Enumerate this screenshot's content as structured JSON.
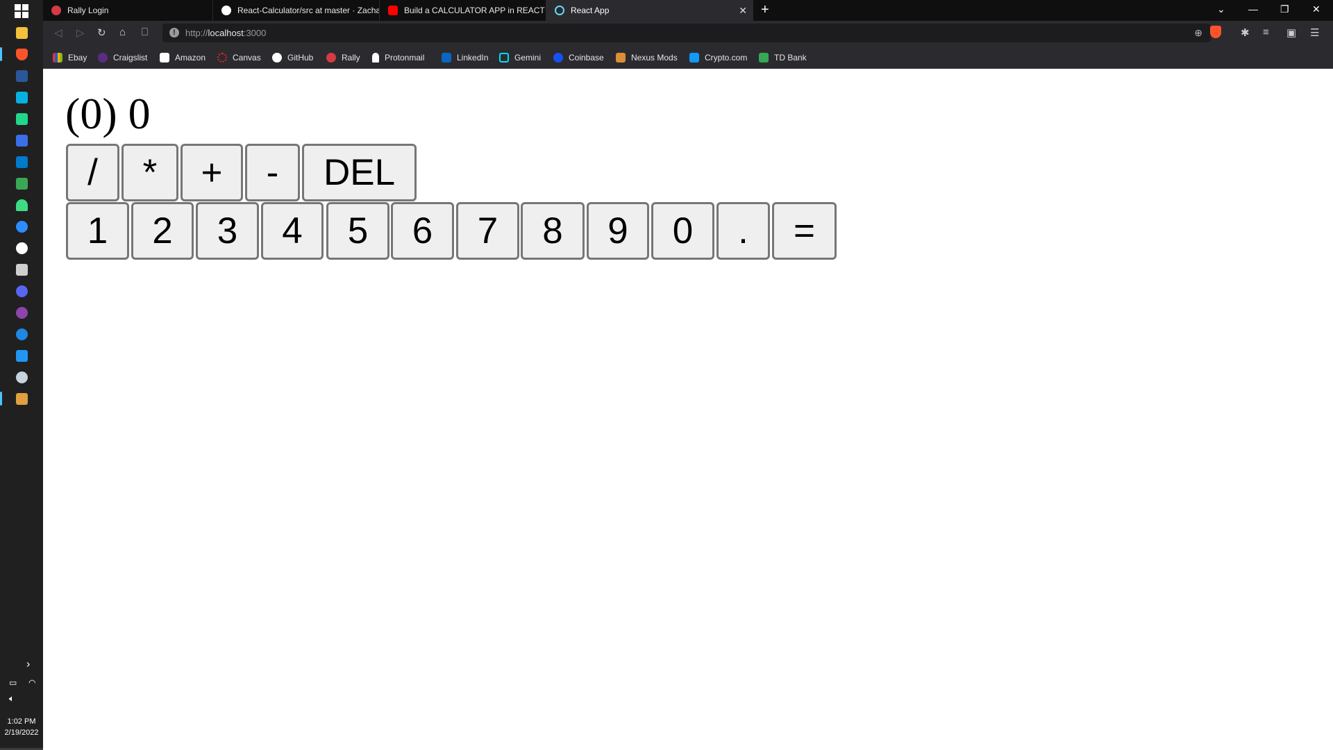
{
  "taskbar": {
    "time": "1:02 PM",
    "date": "2/19/2022"
  },
  "tabs": [
    {
      "title": "Rally Login",
      "color": "#d63a45"
    },
    {
      "title": "React-Calculator/src at master · Zachary",
      "color": "#ffffff"
    },
    {
      "title": "Build a CALCULATOR APP in REACT JS",
      "color": "#ff0000"
    },
    {
      "title": "React App",
      "color": "#61dafb"
    }
  ],
  "toolbar": {
    "url_prefix": "http://",
    "url_host": "localhost",
    "url_suffix": ":3000"
  },
  "bookmarks": [
    {
      "label": "Ebay",
      "color": "#e53238"
    },
    {
      "label": "Craigslist",
      "color": "#5a2d82"
    },
    {
      "label": "Amazon",
      "color": "#ffffff"
    },
    {
      "label": "Canvas",
      "color": "#e4222e"
    },
    {
      "label": "GitHub",
      "color": "#ffffff"
    },
    {
      "label": "Rally",
      "color": "#d63a45"
    },
    {
      "label": "Protonmail",
      "color": "#ffffff"
    },
    {
      "label": "LinkedIn",
      "color": "#0a66c2"
    },
    {
      "label": "Gemini",
      "color": "#00dcfa"
    },
    {
      "label": "Coinbase",
      "color": "#1652f0"
    },
    {
      "label": "Nexus Mods",
      "color": "#da8e35"
    },
    {
      "label": "Crypto.com",
      "color": "#1199fa"
    },
    {
      "label": "TD Bank",
      "color": "#34a853"
    }
  ],
  "calculator": {
    "output": "(0) 0",
    "operators": [
      "/",
      "*",
      "+",
      "-",
      "DEL"
    ],
    "digits": [
      "1",
      "2",
      "3",
      "4",
      "5",
      "6",
      "7",
      "8",
      "9",
      "0",
      ".",
      "="
    ]
  }
}
